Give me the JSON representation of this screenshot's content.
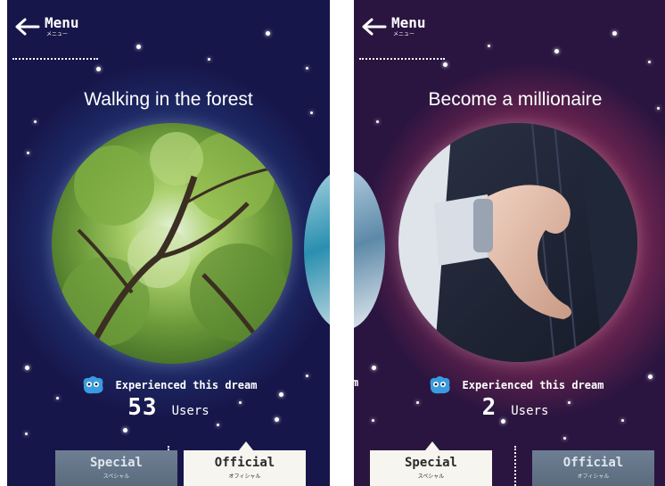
{
  "screens": [
    {
      "menu_label": "Menu",
      "menu_sub": "メニュー",
      "title": "Walking in the forest",
      "experienced_label": "Experienced this dream",
      "count": "53",
      "users_label": "Users",
      "tabs": [
        {
          "label": "Special",
          "sub": "スペシャル",
          "active": false
        },
        {
          "label": "Official",
          "sub": "オフィシャル",
          "active": true
        }
      ],
      "image_subject": "forest-canopy"
    },
    {
      "menu_label": "Menu",
      "menu_sub": "メニュー",
      "title": "Become a millionaire",
      "experienced_label": "Experienced this dream",
      "count": "2",
      "users_label": "Users",
      "peek_text": "m",
      "tabs": [
        {
          "label": "Special",
          "sub": "スペシャル",
          "active": true
        },
        {
          "label": "Official",
          "sub": "オフィシャル",
          "active": false
        }
      ],
      "image_subject": "businessman-handshake"
    }
  ],
  "colors": {
    "forest_theme": "#1a6d98",
    "millionaire_theme": "#b8384c",
    "blob": "#3a9be0",
    "tab_active_bg": "#f6f5ef",
    "tab_inactive_bg": "#6e7f93"
  },
  "icons": [
    "back-arrow-icon",
    "mascot-blob-icon"
  ]
}
